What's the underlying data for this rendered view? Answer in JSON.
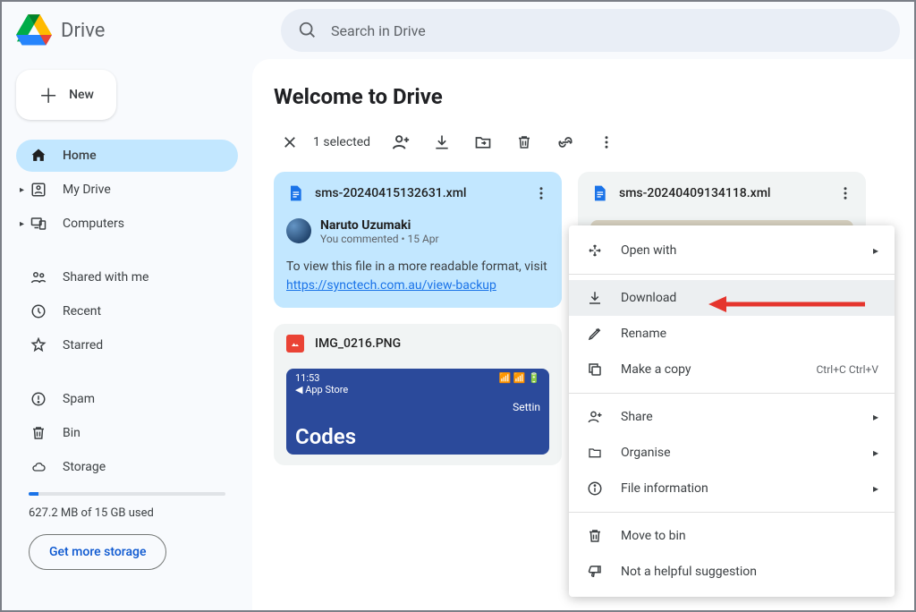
{
  "app": {
    "name": "Drive"
  },
  "search": {
    "placeholder": "Search in Drive"
  },
  "newButton": {
    "label": "New"
  },
  "sidebar": {
    "items": [
      {
        "label": "Home"
      },
      {
        "label": "My Drive"
      },
      {
        "label": "Computers"
      },
      {
        "label": "Shared with me"
      },
      {
        "label": "Recent"
      },
      {
        "label": "Starred"
      },
      {
        "label": "Spam"
      },
      {
        "label": "Bin"
      },
      {
        "label": "Storage"
      }
    ],
    "storage": {
      "used_text": "627.2 MB of 15 GB used",
      "percent": 5
    },
    "get_more": "Get more storage"
  },
  "main": {
    "title": "Welcome to Drive",
    "selection_text": "1 selected"
  },
  "cards": {
    "file1": {
      "name": "sms-20240415132631.xml",
      "commenter": "Naruto Uzumaki",
      "commenter_sub": "You commented • 15 Apr",
      "body_pre": "To view this file in a more readable format, visit ",
      "link": "https://synctech.com.au/view-backup"
    },
    "file2": {
      "name": "sms-20240409134118.xml"
    },
    "file3": {
      "name": "IMG_0216.PNG",
      "preview_time": "11:53",
      "preview_sub": "App Store",
      "preview_settings": "Settin",
      "preview_codes": "Codes"
    }
  },
  "context_menu": {
    "open_with": "Open with",
    "download": "Download",
    "rename": "Rename",
    "make_copy": "Make a copy",
    "make_copy_shortcut": "Ctrl+C Ctrl+V",
    "share": "Share",
    "organise": "Organise",
    "file_info": "File information",
    "move_to_bin": "Move to bin",
    "not_helpful": "Not a helpful suggestion"
  }
}
